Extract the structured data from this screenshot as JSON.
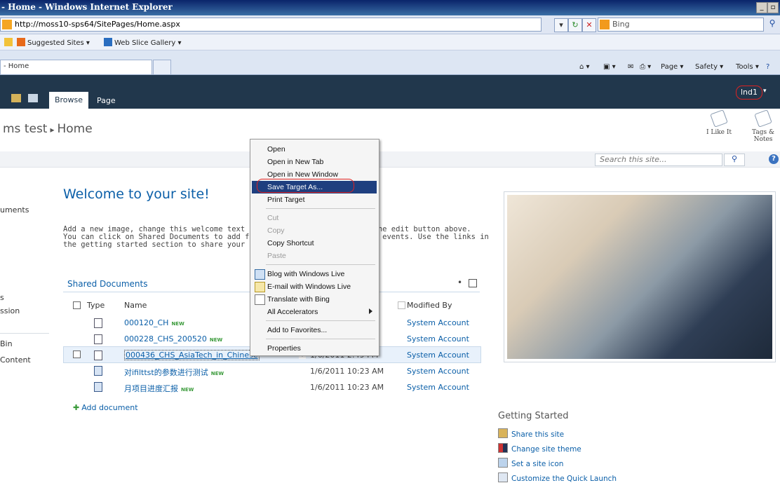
{
  "browser": {
    "window_title": "- Home - Windows Internet Explorer",
    "url_host": "http://moss10-sps64",
    "url_path": "/SitePages/Home.aspx",
    "search_engine": "Bing",
    "favorites": [
      "Suggested Sites ▾",
      "Web Slice Gallery ▾"
    ],
    "tab_title": "- Home",
    "commands": [
      "Page ▾",
      "Safety ▾",
      "Tools ▾"
    ]
  },
  "ribbon": {
    "tabs": [
      "Browse",
      "Page"
    ],
    "user": "lnd1"
  },
  "breadcrumb": {
    "site": "ms test",
    "separator": "▸",
    "page": "Home"
  },
  "social": {
    "like": "I Like It",
    "tags_line1": "Tags &",
    "tags_line2": "Notes"
  },
  "site_search": {
    "placeholder": "Search this site..."
  },
  "quick_launch": [
    "uments",
    "s",
    "ssion",
    "Bin",
    "Content"
  ],
  "main": {
    "heading": "Welcome to your site!",
    "intro_lines": [
      "Add a new image, change this welcome text or a                      g the edit button above.",
      "You can click on Shared Documents to add files c                    eam events. Use the links in",
      "the getting started section to share your site and"
    ]
  },
  "library": {
    "title": "Shared Documents",
    "menu_glyph": "•",
    "columns": [
      "Type",
      "Name",
      "Modified By"
    ],
    "new_badge": "NEW",
    "rows": [
      {
        "name": "000120_CH",
        "modified": "",
        "modified_by": "System Account",
        "new": true
      },
      {
        "name": "000228_CHS_200520",
        "modified": "",
        "modified_by": "System Account",
        "new": true
      },
      {
        "name": "000436_CHS_AsiaTech_in_Chinese",
        "modified": "1/6/2011 2:49 PM",
        "modified_by": "System Account",
        "new": false
      },
      {
        "name": "对ifilttst的参数进行测试",
        "modified": "1/6/2011 10:23 AM",
        "modified_by": "System Account",
        "new": true
      },
      {
        "name": "月项目进度汇报",
        "modified": "1/6/2011 10:23 AM",
        "modified_by": "System Account",
        "new": true
      }
    ],
    "add_document": "Add document"
  },
  "getting_started": {
    "title": "Getting Started",
    "items": [
      "Share this site",
      "Change site theme",
      "Set a site icon",
      "Customize the Quick Launch"
    ]
  },
  "context_menu": {
    "items": [
      {
        "label": "Open",
        "enabled": true
      },
      {
        "label": "Open in New Tab",
        "enabled": true
      },
      {
        "label": "Open in New Window",
        "enabled": true
      },
      {
        "label": "Save Target As...",
        "enabled": true,
        "highlighted": true
      },
      {
        "label": "Print Target",
        "enabled": true
      },
      {
        "label": "Cut",
        "enabled": false
      },
      {
        "label": "Copy",
        "enabled": false
      },
      {
        "label": "Copy Shortcut",
        "enabled": true
      },
      {
        "label": "Paste",
        "enabled": false
      },
      {
        "label": "Blog with Windows Live",
        "enabled": true
      },
      {
        "label": "E-mail with Windows Live",
        "enabled": true
      },
      {
        "label": "Translate with Bing",
        "enabled": true
      },
      {
        "label": "All Accelerators",
        "enabled": true
      },
      {
        "label": "Add to Favorites...",
        "enabled": true
      },
      {
        "label": "Properties",
        "enabled": true
      }
    ]
  },
  "colors": {
    "ribbon_bg": "#21374c",
    "link": "#0b5fa8",
    "menu_highlight": "#1f3f7f",
    "annotation_red": "#dd2222"
  }
}
